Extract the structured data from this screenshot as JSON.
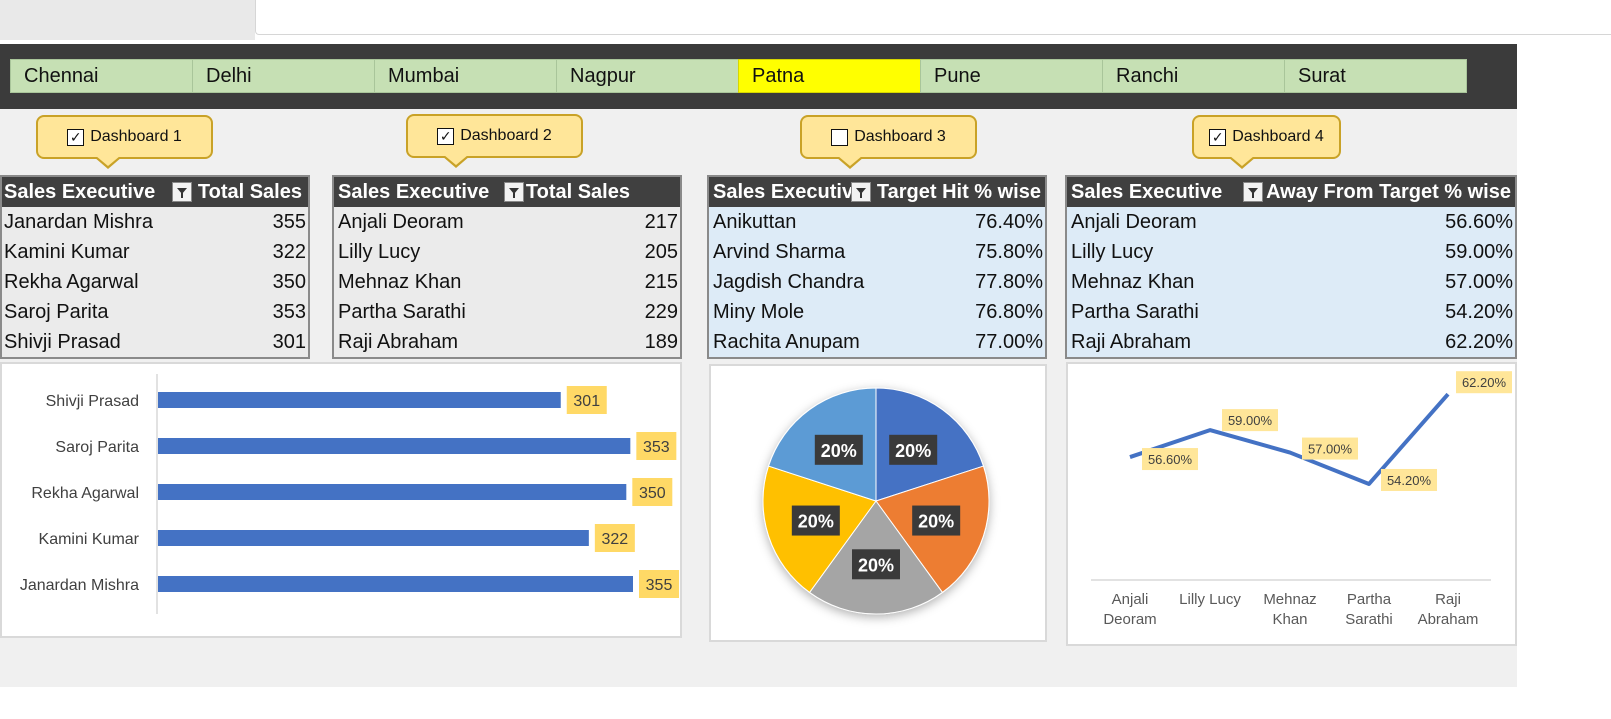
{
  "cities": [
    {
      "label": "Chennai",
      "selected": false
    },
    {
      "label": "Delhi",
      "selected": false
    },
    {
      "label": "Mumbai",
      "selected": false
    },
    {
      "label": "Nagpur",
      "selected": false
    },
    {
      "label": "Patna",
      "selected": true
    },
    {
      "label": "Pune",
      "selected": false
    },
    {
      "label": "Ranchi",
      "selected": false
    },
    {
      "label": "Surat",
      "selected": false
    }
  ],
  "dashboards": [
    {
      "label": "Dashboard 1",
      "checked": true
    },
    {
      "label": "Dashboard 2",
      "checked": true
    },
    {
      "label": "Dashboard 3",
      "checked": false
    },
    {
      "label": "Dashboard 4",
      "checked": true
    }
  ],
  "table1": {
    "col1": "Sales Executive",
    "col2": "Total Sales",
    "rows": [
      {
        "name": "Janardan Mishra",
        "value": "355"
      },
      {
        "name": "Kamini Kumar",
        "value": "322"
      },
      {
        "name": "Rekha Agarwal",
        "value": "350"
      },
      {
        "name": "Saroj Parita",
        "value": "353"
      },
      {
        "name": "Shivji Prasad",
        "value": "301"
      }
    ]
  },
  "table2": {
    "col1": "Sales Executive",
    "col2": "Total Sales",
    "rows": [
      {
        "name": "Anjali Deoram",
        "value": "217"
      },
      {
        "name": "Lilly Lucy",
        "value": "205"
      },
      {
        "name": "Mehnaz Khan",
        "value": "215"
      },
      {
        "name": "Partha Sarathi",
        "value": "229"
      },
      {
        "name": "Raji Abraham",
        "value": "189"
      }
    ]
  },
  "table3": {
    "col1": "Sales Executive",
    "col2": "Target Hit % wise",
    "rows": [
      {
        "name": "Anikuttan",
        "value": "76.40%"
      },
      {
        "name": "Arvind Sharma",
        "value": "75.80%"
      },
      {
        "name": "Jagdish Chandra",
        "value": "77.80%"
      },
      {
        "name": "Miny Mole",
        "value": "76.80%"
      },
      {
        "name": "Rachita Anupam",
        "value": "77.00%"
      }
    ]
  },
  "table4": {
    "col1": "Sales Executive",
    "col2": "Away From Target % wise",
    "rows": [
      {
        "name": "Anjali Deoram",
        "value": "56.60%"
      },
      {
        "name": "Lilly Lucy",
        "value": "59.00%"
      },
      {
        "name": "Mehnaz Khan",
        "value": "57.00%"
      },
      {
        "name": "Partha Sarathi",
        "value": "54.20%"
      },
      {
        "name": "Raji Abraham",
        "value": "62.20%"
      }
    ]
  },
  "colors": {
    "bar": "#4472c4",
    "label_bg": "#ffd966",
    "line": "#4472c4",
    "line_label_bg": "#ffe699",
    "pie": [
      "#4472c4",
      "#ed7d31",
      "#a5a5a5",
      "#ffc000",
      "#5b9bd5"
    ],
    "slicer_selected": "#ffff00",
    "slicer": "#c6e0b4"
  },
  "chart_data": [
    {
      "type": "bar",
      "orientation": "horizontal",
      "categories": [
        "Shivji Prasad",
        "Saroj Parita",
        "Rekha Agarwal",
        "Kamini Kumar",
        "Janardan Mishra"
      ],
      "values": [
        301,
        353,
        350,
        322,
        355
      ],
      "labels": [
        "301",
        "353",
        "350",
        "322",
        "355"
      ],
      "xlim": [
        0,
        360
      ]
    },
    {
      "type": "pie",
      "values": [
        20,
        20,
        20,
        20,
        20
      ],
      "labels": [
        "20%",
        "20%",
        "20%",
        "20%",
        "20%"
      ]
    },
    {
      "type": "line",
      "categories": [
        [
          "Anjali",
          "Deoram"
        ],
        [
          "Lilly Lucy"
        ],
        [
          "Mehnaz",
          "Khan"
        ],
        [
          "Partha",
          "Sarathi"
        ],
        [
          "Raji",
          "Abraham"
        ]
      ],
      "values": [
        56.6,
        59.0,
        57.0,
        54.2,
        62.2
      ],
      "labels": [
        "56.60%",
        "59.00%",
        "57.00%",
        "54.20%",
        "62.20%"
      ],
      "ylim": [
        46,
        64
      ]
    }
  ]
}
